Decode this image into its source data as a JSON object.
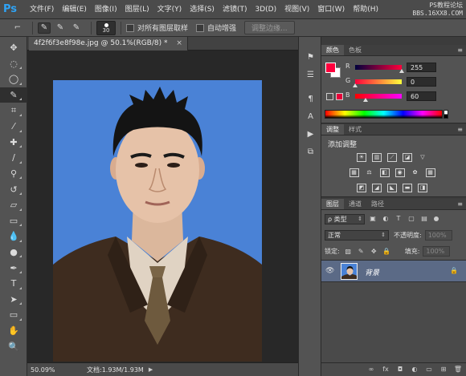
{
  "app": {
    "logo": "Ps",
    "watermark_line1": "PS教程论坛",
    "watermark_line2": "BBS.16XX8.COM"
  },
  "menu": [
    "文件(F)",
    "编辑(E)",
    "图像(I)",
    "图层(L)",
    "文字(Y)",
    "选择(S)",
    "滤镜(T)",
    "3D(D)",
    "视图(V)",
    "窗口(W)",
    "帮助(H)"
  ],
  "options": {
    "brush_size": "30",
    "sample_all_layers": "对所有图层取样",
    "auto_enhance": "自动增强",
    "refine_edge": "调整边缘..."
  },
  "document": {
    "tab_label": "4f2f6f3e8f98e.jpg @ 50.1%(RGB/8) *",
    "close_glyph": "×",
    "zoom": "50.09%",
    "doc_info": "文档:1.93M/1.93M",
    "status_arrow": "▶"
  },
  "color_panel": {
    "tabs": [
      "颜色",
      "色板"
    ],
    "r_label": "R",
    "r_value": "255",
    "g_label": "G",
    "g_value": "0",
    "b_label": "B",
    "b_value": "60",
    "fg_color": "#ff003c",
    "bg_color": "#ffffff"
  },
  "adjustments_panel": {
    "tabs": [
      "调整",
      "样式"
    ],
    "title": "添加调整"
  },
  "layers_panel": {
    "tabs": [
      "图层",
      "通道",
      "路径"
    ],
    "filter_kind": "ρ 类型",
    "blend_mode": "正常",
    "opacity_label": "不透明度:",
    "opacity_value": "100%",
    "lock_label": "锁定:",
    "fill_label": "填充:",
    "fill_value": "100%",
    "layers": [
      {
        "name": "背景",
        "visible": true,
        "locked": true
      }
    ]
  },
  "icons": {
    "tools": [
      "move-icon",
      "marquee-icon",
      "lasso-icon",
      "quick-selection-icon",
      "crop-icon",
      "eyedropper-icon",
      "healing-brush-icon",
      "brush-icon",
      "clone-stamp-icon",
      "history-brush-icon",
      "eraser-icon",
      "gradient-icon",
      "blur-icon",
      "dodge-icon",
      "pen-icon",
      "type-icon",
      "path-selection-icon",
      "rectangle-icon",
      "hand-icon",
      "zoom-icon"
    ]
  }
}
